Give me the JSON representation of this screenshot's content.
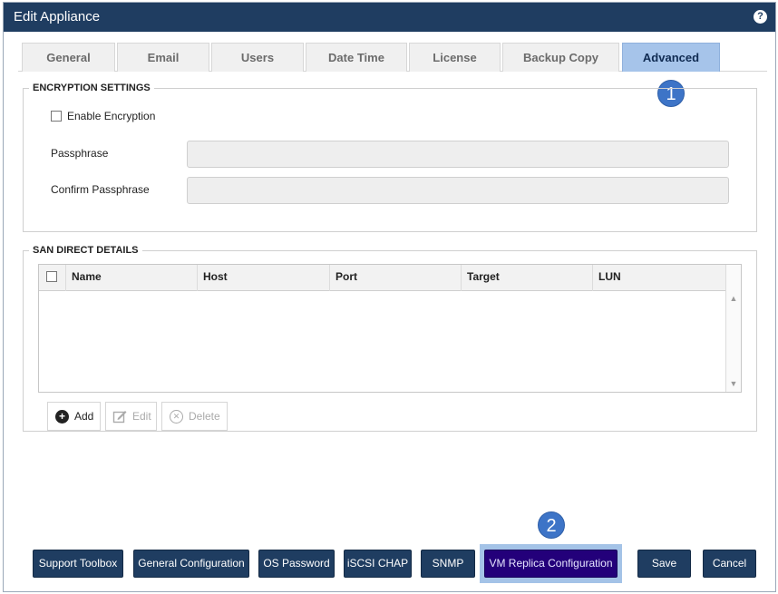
{
  "window": {
    "title": "Edit Appliance"
  },
  "tabs": [
    {
      "label": "General"
    },
    {
      "label": "Email"
    },
    {
      "label": "Users"
    },
    {
      "label": "Date Time"
    },
    {
      "label": "License"
    },
    {
      "label": "Backup Copy"
    },
    {
      "label": "Advanced",
      "active": true
    }
  ],
  "callouts": {
    "one": "1",
    "two": "2"
  },
  "encryption": {
    "legend": "ENCRYPTION SETTINGS",
    "enable_label": "Enable Encryption",
    "enabled": false,
    "passphrase_label": "Passphrase",
    "passphrase_value": "",
    "confirm_label": "Confirm Passphrase",
    "confirm_value": ""
  },
  "san": {
    "legend": "SAN DIRECT DETAILS",
    "columns": [
      "Name",
      "Host",
      "Port",
      "Target",
      "LUN"
    ],
    "rows": [],
    "toolbar": {
      "add": "Add",
      "edit": "Edit",
      "delete": "Delete"
    }
  },
  "footer": {
    "support_toolbox": "Support Toolbox",
    "general_configuration": "General Configuration",
    "os_password": "OS Password",
    "iscsi_chap": "iSCSI CHAP",
    "snmp": "SNMP",
    "vm_replica": "VM Replica Configuration",
    "save": "Save",
    "cancel": "Cancel"
  },
  "colors": {
    "titlebar": "#1f3d61",
    "active_tab": "#a6c4ea",
    "button": "#1f3d61",
    "vm_button": "#23007a",
    "callout": "#3d74c7"
  },
  "icons": {
    "help": "help-icon",
    "add": "plus-circle-icon",
    "edit": "pencil-square-icon",
    "delete": "x-circle-icon"
  }
}
